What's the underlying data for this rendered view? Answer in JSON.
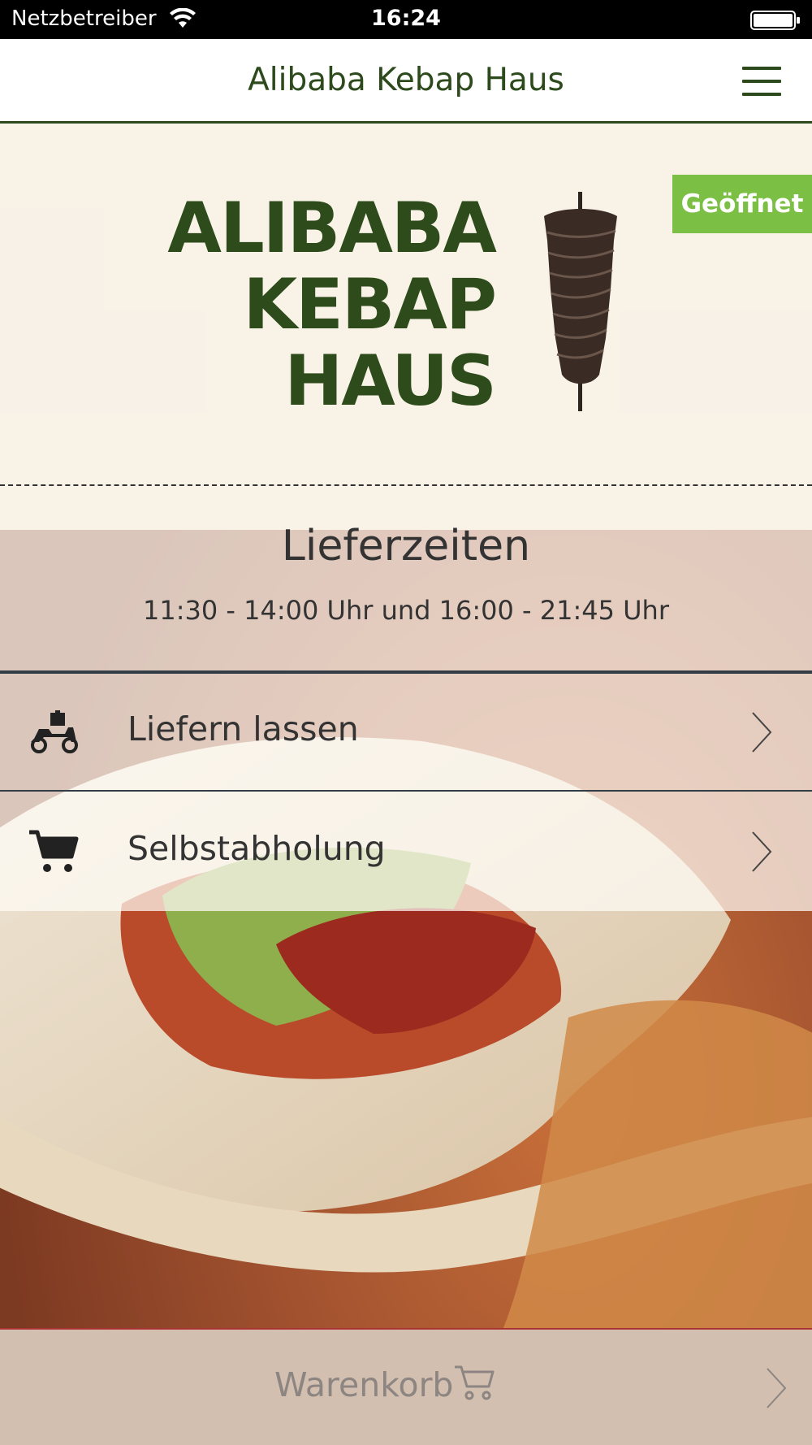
{
  "status_bar": {
    "carrier": "Netzbetreiber",
    "time": "16:24"
  },
  "nav": {
    "title": "Alibaba Kebap Haus",
    "menu_icon": "hamburger-menu-icon"
  },
  "status_badge": "Geöffnet",
  "logo": {
    "line1": "ALIBABA",
    "line2": "KEBAP",
    "line3": "HAUS"
  },
  "delivery_hours": {
    "title": "Lieferzeiten",
    "times": "11:30 - 14:00 Uhr und 16:00 - 21:45 Uhr"
  },
  "options": [
    {
      "label": "Liefern lassen",
      "icon": "delivery-scooter-icon"
    },
    {
      "label": "Selbstabholung",
      "icon": "shopping-cart-icon"
    }
  ],
  "cart": {
    "label": "Warenkorb",
    "icon": "shopping-cart-icon"
  },
  "colors": {
    "brand_green": "#2c4a1c",
    "open_badge": "#7bbf45",
    "cart_bar": "#d2bfb0"
  }
}
